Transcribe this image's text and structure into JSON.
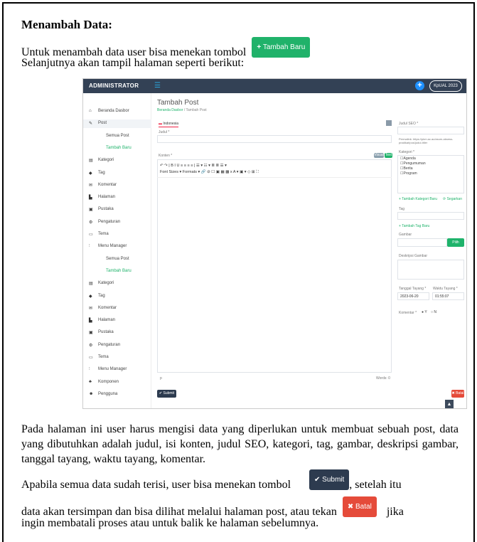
{
  "heading": "Menambah Data:",
  "intro_line1": "Untuk menambah data user bisa menekan tombol",
  "tambah_baru_btn": "Tambah Baru",
  "intro_line2": "Selanjutnya akan tampil halaman seperti berikut:",
  "screenshot": {
    "brand": "ADMINISTRATOR",
    "user": "KpUAL 2023",
    "page_title": "Tambah Post",
    "breadcrumb_home": "Beranda Dasbor",
    "breadcrumb_sep": "/",
    "breadcrumb_current": "Tambah Post",
    "tab_lang": "Indonesia",
    "label_judul": "Judul *",
    "label_konten": "Konten *",
    "visual_btn": "Visual",
    "text_btn": "Text",
    "toolbar_row1": "↶  ↷  |  B  I  U  ≡  ≡  ≡  ≡  |  ☰ ▾  ☷ ▾  ≣  ≣  ☰ ▾",
    "toolbar_row2": "Font Sizes ▾   Formats ▾   🔗  ⊘  ☐  ▣  ▦  ▩  x  A ▾  ▣ ▾  ◇  ⊞  ⛶",
    "editor_footer_p": "p",
    "words": "Words: 0",
    "submit_btn": "✔ Submit",
    "batal_btn": "✖ Batal",
    "label_seo": "Judul SEO *",
    "permalink": "Permalink: https://pkm.ac.ac/asum-aksess-pradikat/pos/judul-titler",
    "label_kategori": "Kategori *",
    "kategori_items": [
      "Agenda",
      "Pengumuman",
      "Berita",
      "Program"
    ],
    "add_kategori": "+ Tambah Kategori Baru",
    "segarkan": "⟳ Segarkan",
    "label_tag": "Tag",
    "add_tag": "+ Tambah Tag Baru",
    "label_gambar": "Gambar",
    "pilih_gambar": "Pilih Gambar",
    "label_desk": "Deskripsi Gambar",
    "label_tanggal": "Tanggal Tayang *",
    "label_waktu": "Waktu Tayang *",
    "tanggal_value": "2023-06-20",
    "waktu_value": "01:55:07",
    "label_komentar": "Komentar *",
    "komentar_ya": "Y",
    "komentar_tidak": "N",
    "sidebar": [
      {
        "icon": "⌂",
        "label": "Beranda Dasbor",
        "type": "main"
      },
      {
        "icon": "✎",
        "label": "Post",
        "type": "main-active"
      },
      {
        "icon": "",
        "label": "Semua Post",
        "type": "sub"
      },
      {
        "icon": "",
        "label": "Tambah Baru",
        "type": "sub-active"
      },
      {
        "icon": "▤",
        "label": "Kategori",
        "type": "main"
      },
      {
        "icon": "◆",
        "label": "Tag",
        "type": "main"
      },
      {
        "icon": "✉",
        "label": "Komentar",
        "type": "main"
      },
      {
        "icon": "▙",
        "label": "Halaman",
        "type": "main"
      },
      {
        "icon": "▣",
        "label": "Pustaka",
        "type": "main"
      },
      {
        "icon": "⚙",
        "label": "Pengaturan",
        "type": "main"
      },
      {
        "icon": "▭",
        "label": "Tema",
        "type": "main"
      },
      {
        "icon": "⫶",
        "label": "Menu Manager",
        "type": "main"
      },
      {
        "icon": "",
        "label": "Semua Post",
        "type": "sub"
      },
      {
        "icon": "",
        "label": "Tambah Baru",
        "type": "sub-active"
      },
      {
        "icon": "▤",
        "label": "Kategori",
        "type": "main"
      },
      {
        "icon": "◆",
        "label": "Tag",
        "type": "main"
      },
      {
        "icon": "✉",
        "label": "Komentar",
        "type": "main"
      },
      {
        "icon": "▙",
        "label": "Halaman",
        "type": "main"
      },
      {
        "icon": "▣",
        "label": "Pustaka",
        "type": "main"
      },
      {
        "icon": "⚙",
        "label": "Pengaturan",
        "type": "main"
      },
      {
        "icon": "▭",
        "label": "Tema",
        "type": "main"
      },
      {
        "icon": "⫶",
        "label": "Menu Manager",
        "type": "main"
      },
      {
        "icon": "♣",
        "label": "Komponen",
        "type": "main"
      },
      {
        "icon": "☻",
        "label": "Pengguna",
        "type": "main"
      }
    ]
  },
  "body_para1": "Pada halaman ini user harus mengisi data yang diperlukan untuk membuat sebuah post, data yang dibutuhkan adalah judul, isi konten, judul SEO, kategori, tag, gambar, deskripsi gambar, tanggal tayang, waktu tayang, komentar.",
  "body_para2_a": "Apabila semua data sudah terisi, user bisa menekan tombol",
  "submit_inline": "✔ Submit",
  "body_para2_b": ", setelah itu",
  "body_para3_a": "data akan tersimpan dan bisa dilihat melalui halaman post, atau tekan",
  "batal_inline": "✖ Batal",
  "body_para3_b": "jika",
  "body_para4": "ingin membatali proses atau untuk balik ke halaman sebelumnya."
}
